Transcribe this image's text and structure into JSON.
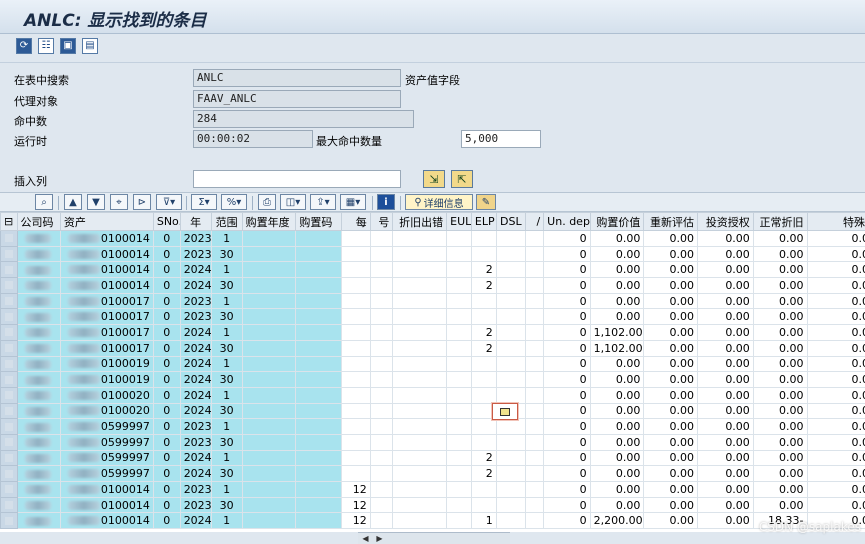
{
  "title": "ANLC: 显示找到的条目",
  "toolbar_icons": [
    "refresh-icon",
    "tree-icon",
    "layout-icon",
    "export-icon"
  ],
  "form": {
    "search_table_label": "在表中搜索",
    "search_table_value": "ANLC",
    "asset_value_field_label": "资产值字段",
    "proxy_object_label": "代理对象",
    "proxy_object_value": "FAAV_ANLC",
    "hits_label": "命中数",
    "hits_value": "284",
    "runtime_label": "运行时",
    "runtime_value": "00:00:02",
    "max_hits_label": "最大命中数量",
    "max_hits_value": "5,000",
    "insert_column_label": "插入列",
    "insert_column_value": ""
  },
  "grid_toolbar": {
    "detail_label": "详细信息"
  },
  "columns": [
    "公司码",
    "资产",
    "SNo.",
    "年",
    "范围",
    "购置年度",
    "购置码",
    "每",
    "号",
    "折旧出错",
    "EUL",
    "ELP",
    "DSL",
    "/",
    "Un. dep",
    "购置价值",
    "重新评估",
    "投资授权",
    "正常折旧",
    "特殊折"
  ],
  "rows": [
    {
      "asset": "0100014",
      "sno": "0",
      "year": "2023",
      "area": "1",
      "per": "",
      "elp": "",
      "undep": "0",
      "acq": "0.00",
      "reval": "0.00",
      "invest": "0.00",
      "ord": "0.00",
      "spec": "0.00"
    },
    {
      "asset": "0100014",
      "sno": "0",
      "year": "2023",
      "area": "30",
      "per": "",
      "elp": "",
      "undep": "0",
      "acq": "0.00",
      "reval": "0.00",
      "invest": "0.00",
      "ord": "0.00",
      "spec": "0.00"
    },
    {
      "asset": "0100014",
      "sno": "0",
      "year": "2024",
      "area": "1",
      "per": "",
      "elp": "2",
      "undep": "0",
      "acq": "0.00",
      "reval": "0.00",
      "invest": "0.00",
      "ord": "0.00",
      "spec": "0.00"
    },
    {
      "asset": "0100014",
      "sno": "0",
      "year": "2024",
      "area": "30",
      "per": "",
      "elp": "2",
      "undep": "0",
      "acq": "0.00",
      "reval": "0.00",
      "invest": "0.00",
      "ord": "0.00",
      "spec": "0.00"
    },
    {
      "asset": "0100017",
      "sno": "0",
      "year": "2023",
      "area": "1",
      "per": "",
      "elp": "",
      "undep": "0",
      "acq": "0.00",
      "reval": "0.00",
      "invest": "0.00",
      "ord": "0.00",
      "spec": "0.00"
    },
    {
      "asset": "0100017",
      "sno": "0",
      "year": "2023",
      "area": "30",
      "per": "",
      "elp": "",
      "undep": "0",
      "acq": "0.00",
      "reval": "0.00",
      "invest": "0.00",
      "ord": "0.00",
      "spec": "0.00"
    },
    {
      "asset": "0100017",
      "sno": "0",
      "year": "2024",
      "area": "1",
      "per": "",
      "elp": "2",
      "undep": "0",
      "acq": "1,102.00",
      "reval": "0.00",
      "invest": "0.00",
      "ord": "0.00",
      "spec": "0.00"
    },
    {
      "asset": "0100017",
      "sno": "0",
      "year": "2024",
      "area": "30",
      "per": "",
      "elp": "2",
      "undep": "0",
      "acq": "1,102.00",
      "reval": "0.00",
      "invest": "0.00",
      "ord": "0.00",
      "spec": "0.00"
    },
    {
      "asset": "0100019",
      "sno": "0",
      "year": "2024",
      "area": "1",
      "per": "",
      "elp": "",
      "undep": "0",
      "acq": "0.00",
      "reval": "0.00",
      "invest": "0.00",
      "ord": "0.00",
      "spec": "0.00"
    },
    {
      "asset": "0100019",
      "sno": "0",
      "year": "2024",
      "area": "30",
      "per": "",
      "elp": "",
      "undep": "0",
      "acq": "0.00",
      "reval": "0.00",
      "invest": "0.00",
      "ord": "0.00",
      "spec": "0.00"
    },
    {
      "asset": "0100020",
      "sno": "0",
      "year": "2024",
      "area": "1",
      "per": "",
      "elp": "",
      "undep": "0",
      "acq": "0.00",
      "reval": "0.00",
      "invest": "0.00",
      "ord": "0.00",
      "spec": "0.00"
    },
    {
      "asset": "0100020",
      "sno": "0",
      "year": "2024",
      "area": "30",
      "per": "",
      "elp": "",
      "undep": "0",
      "acq": "0.00",
      "reval": "0.00",
      "invest": "0.00",
      "ord": "0.00",
      "spec": "0.00"
    },
    {
      "asset": "0599997",
      "sno": "0",
      "year": "2023",
      "area": "1",
      "per": "",
      "elp": "",
      "undep": "0",
      "acq": "0.00",
      "reval": "0.00",
      "invest": "0.00",
      "ord": "0.00",
      "spec": "0.00"
    },
    {
      "asset": "0599997",
      "sno": "0",
      "year": "2023",
      "area": "30",
      "per": "",
      "elp": "",
      "undep": "0",
      "acq": "0.00",
      "reval": "0.00",
      "invest": "0.00",
      "ord": "0.00",
      "spec": "0.00"
    },
    {
      "asset": "0599997",
      "sno": "0",
      "year": "2024",
      "area": "1",
      "per": "",
      "elp": "2",
      "undep": "0",
      "acq": "0.00",
      "reval": "0.00",
      "invest": "0.00",
      "ord": "0.00",
      "spec": "0.00"
    },
    {
      "asset": "0599997",
      "sno": "0",
      "year": "2024",
      "area": "30",
      "per": "",
      "elp": "2",
      "undep": "0",
      "acq": "0.00",
      "reval": "0.00",
      "invest": "0.00",
      "ord": "0.00",
      "spec": "0.00"
    },
    {
      "asset": "0100014",
      "sno": "0",
      "year": "2023",
      "area": "1",
      "per": "12",
      "elp": "",
      "undep": "0",
      "acq": "0.00",
      "reval": "0.00",
      "invest": "0.00",
      "ord": "0.00",
      "spec": "0.00"
    },
    {
      "asset": "0100014",
      "sno": "0",
      "year": "2023",
      "area": "30",
      "per": "12",
      "elp": "",
      "undep": "0",
      "acq": "0.00",
      "reval": "0.00",
      "invest": "0.00",
      "ord": "0.00",
      "spec": "0.00"
    },
    {
      "asset": "0100014",
      "sno": "0",
      "year": "2024",
      "area": "1",
      "per": "12",
      "elp": "1",
      "undep": "0",
      "acq": "2,200.00",
      "reval": "0.00",
      "invest": "0.00",
      "ord": "18.33-",
      "spec": "0.00"
    }
  ],
  "watermark": "CSDN @saplakes"
}
